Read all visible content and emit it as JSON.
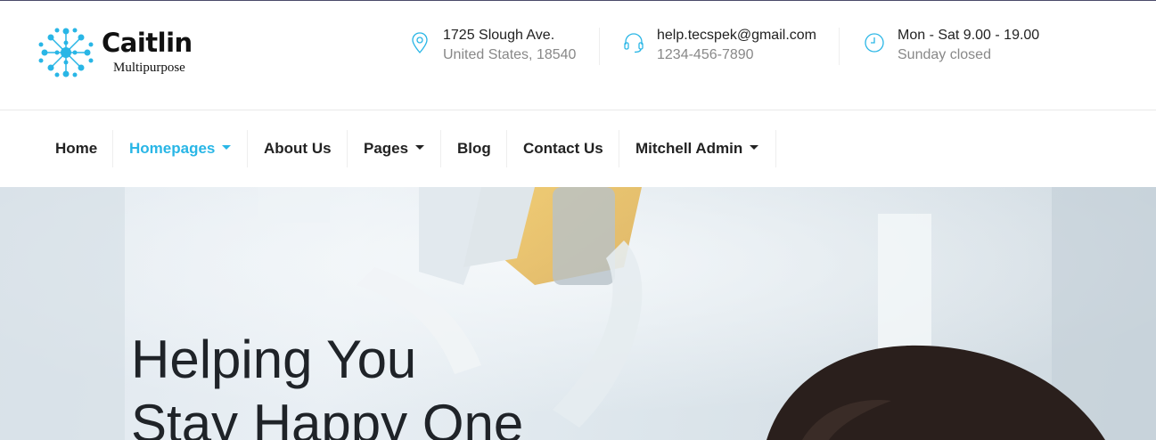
{
  "logo": {
    "name": "Caitlin",
    "subtitle": "Multipurpose",
    "icon": "network-dots-icon"
  },
  "contact": [
    {
      "icon": "map-pin-icon",
      "line1": "1725 Slough Ave.",
      "line2": "United States, 18540"
    },
    {
      "icon": "headset-icon",
      "line1": "help.tecspek@gmail.com",
      "line2": "1234-456-7890"
    },
    {
      "icon": "clock-icon",
      "line1": "Mon - Sat 9.00 - 19.00",
      "line2": "Sunday closed"
    }
  ],
  "nav": [
    {
      "label": "Home",
      "active": false,
      "dropdown": false
    },
    {
      "label": "Homepages",
      "active": true,
      "dropdown": true
    },
    {
      "label": "About Us",
      "active": false,
      "dropdown": false
    },
    {
      "label": "Pages",
      "active": false,
      "dropdown": true
    },
    {
      "label": "Blog",
      "active": false,
      "dropdown": false
    },
    {
      "label": "Contact Us",
      "active": false,
      "dropdown": false
    },
    {
      "label": "Mitchell Admin",
      "active": false,
      "dropdown": true
    }
  ],
  "hero": {
    "title_line1": "Helping You",
    "title_line2": "Stay Happy One"
  },
  "colors": {
    "accent": "#29b6e6",
    "text": "#222222",
    "muted": "#888888"
  }
}
